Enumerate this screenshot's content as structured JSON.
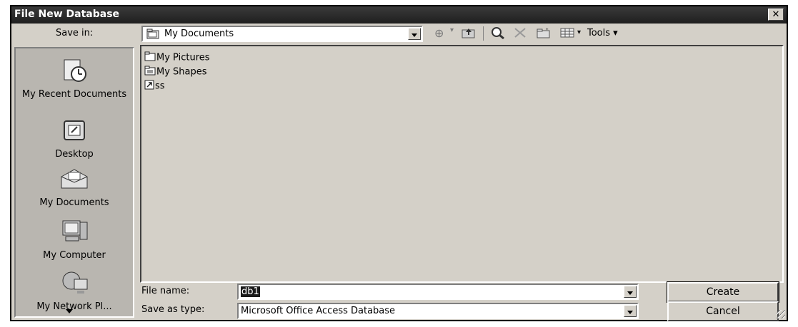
{
  "dialog": {
    "title": "File New Database",
    "close_label": "✕"
  },
  "save_in": {
    "label": "Save in:",
    "value": "My Documents",
    "tools_label": "Tools ▾"
  },
  "places": [
    {
      "label": "My Recent Documents"
    },
    {
      "label": "Desktop"
    },
    {
      "label": "My Documents"
    },
    {
      "label": "My Computer"
    },
    {
      "label": "My Network Pl..."
    }
  ],
  "files": [
    {
      "name": "My Pictures",
      "icon": "folder-icon"
    },
    {
      "name": "My Shapes",
      "icon": "folder-icon"
    },
    {
      "name": "ss",
      "icon": "shortcut-icon"
    }
  ],
  "filename": {
    "label": "File name:",
    "value": "db1"
  },
  "savetype": {
    "label": "Save as type:",
    "value": "Microsoft Office Access Database"
  },
  "buttons": {
    "create": "Create",
    "cancel": "Cancel"
  }
}
